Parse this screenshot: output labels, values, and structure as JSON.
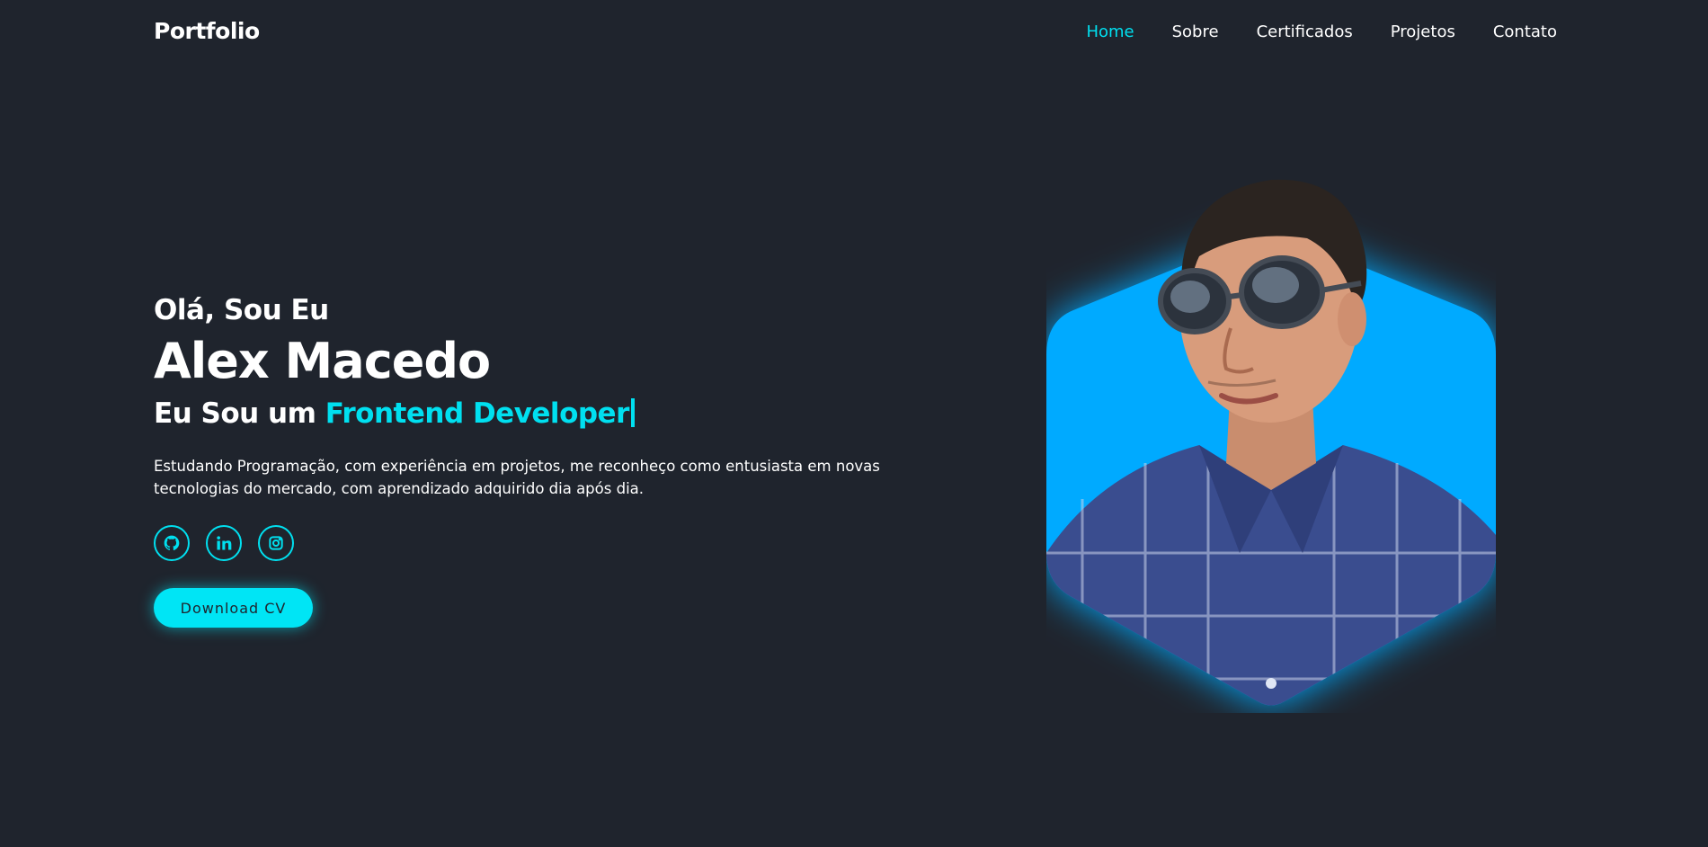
{
  "header": {
    "logo": "Portfolio",
    "nav": [
      {
        "label": "Home",
        "active": true
      },
      {
        "label": "Sobre",
        "active": false
      },
      {
        "label": "Certificados",
        "active": false
      },
      {
        "label": "Projetos",
        "active": false
      },
      {
        "label": "Contato",
        "active": false
      }
    ]
  },
  "hero": {
    "greeting": "Olá, Sou Eu",
    "name": "Alex Macedo",
    "role_prefix": "Eu Sou um",
    "role_accent": "Frontend Developer",
    "description": "Estudando Programação, com experiência em projetos, me reconheço como entusiasta em novas tecnologias do mercado, com aprendizado adquirido dia após dia.",
    "socials": [
      {
        "icon": "github-icon"
      },
      {
        "icon": "linkedin-icon"
      },
      {
        "icon": "instagram-icon"
      }
    ],
    "cv_button": "Download CV"
  },
  "colors": {
    "background": "#1f242d",
    "accent": "#00e0f0",
    "hex_fill": "#00aaff"
  }
}
